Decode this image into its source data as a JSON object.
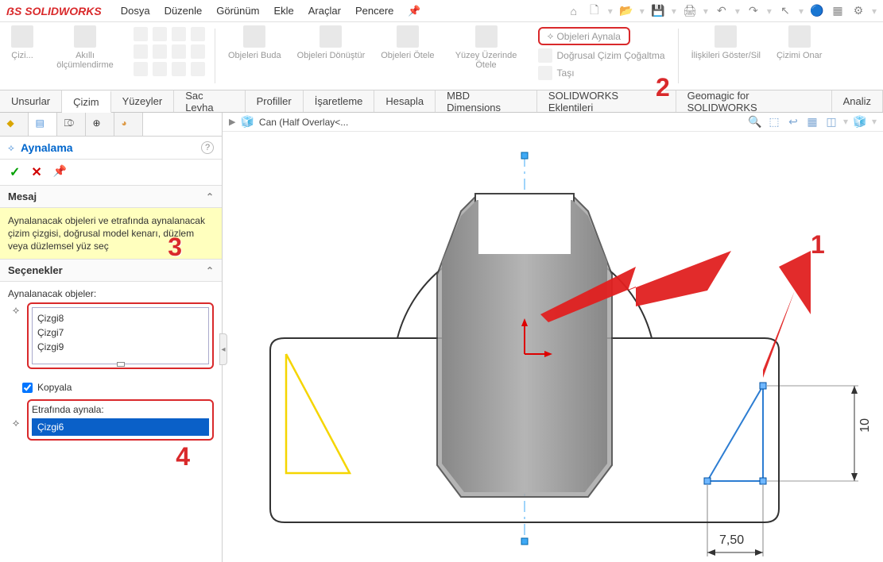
{
  "app": {
    "name": "SOLIDWORKS"
  },
  "menu": {
    "file": "Dosya",
    "edit": "Düzenle",
    "view": "Görünüm",
    "insert": "Ekle",
    "tools": "Araçlar",
    "window": "Pencere"
  },
  "ribbon": {
    "sketch": "Çizi...",
    "smart_dim": "Akıllı ölçümlendirme",
    "trim": "Objeleri Buda",
    "convert": "Objeleri Dönüştür",
    "offset": "Objeleri Ötele",
    "surface_offset": "Yüzey Üzerinde Ötele",
    "mirror": "Objeleri Aynala",
    "linear_pattern": "Doğrusal Çizim Çoğaltma",
    "move": "Taşı",
    "relations": "İlişkileri Göster/Sil",
    "repair": "Çizimi Onar"
  },
  "tabs": {
    "features": "Unsurlar",
    "sketch": "Çizim",
    "surfaces": "Yüzeyler",
    "sheet_metal": "Sac Levha",
    "profiles": "Profiller",
    "markup": "İşaretleme",
    "evaluate": "Hesapla",
    "mbd": "MBD Dimensions",
    "addins": "SOLIDWORKS Eklentileri",
    "geomagic": "Geomagic for SOLIDWORKS",
    "analysis": "Analiz"
  },
  "part": {
    "name": "Can  (Half Overlay<..."
  },
  "prop": {
    "title": "Aynalama",
    "msg_header": "Mesaj",
    "msg_body": "Aynalanacak objeleri ve etrafında aynalanacak çizim çizgisi, doğrusal model kenarı, düzlem veya düzlemsel yüz seç",
    "options_header": "Seçenekler",
    "entities_label": "Aynalanacak objeler:",
    "entities": {
      "e0": "Çizgi8",
      "e1": "Çizgi7",
      "e2": "Çizgi9"
    },
    "copy_label": "Kopyala",
    "mirror_about_label": "Etrafında aynala:",
    "mirror_about_value": "Çizgi6"
  },
  "dims": {
    "d1": "10",
    "d2": "7,50"
  },
  "annotations": {
    "a1": "1",
    "a2": "2",
    "a3": "3",
    "a4": "4"
  }
}
